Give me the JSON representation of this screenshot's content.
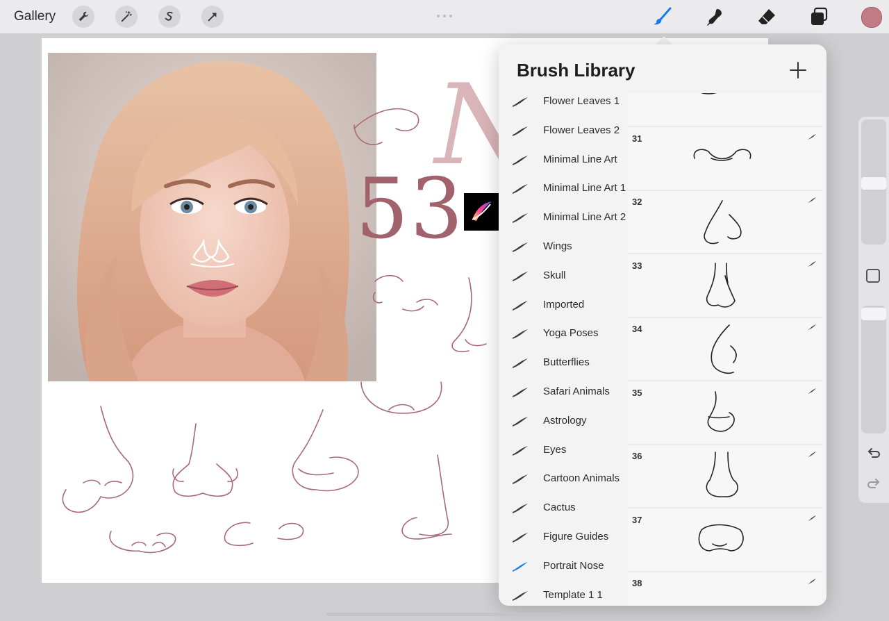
{
  "topbar": {
    "gallery_label": "Gallery",
    "left_tools": [
      "wrench-icon",
      "magic-wand-icon",
      "selection-icon",
      "transform-arrow-icon"
    ],
    "right_tools": [
      "brush-icon",
      "smudge-icon",
      "eraser-icon",
      "layers-icon"
    ],
    "active_tool": "brush-icon",
    "accent_color": "#1a7cf0",
    "current_color": "#c07b84"
  },
  "canvas": {
    "headline_number": "53",
    "headline_letter": "N",
    "text_color": "#a2626c"
  },
  "brush_library": {
    "title": "Brush Library",
    "add_button": "+",
    "sets": [
      {
        "label": "Flower Leaves 1"
      },
      {
        "label": "Flower Leaves 2"
      },
      {
        "label": "Minimal Line Art"
      },
      {
        "label": "Minimal Line Art 1"
      },
      {
        "label": "Minimal Line Art 2"
      },
      {
        "label": "Wings"
      },
      {
        "label": "Skull"
      },
      {
        "label": "Imported"
      },
      {
        "label": "Yoga Poses"
      },
      {
        "label": "Butterflies"
      },
      {
        "label": "Safari Animals"
      },
      {
        "label": "Astrology"
      },
      {
        "label": "Eyes"
      },
      {
        "label": "Cartoon Animals"
      },
      {
        "label": "Cactus"
      },
      {
        "label": "Figure Guides"
      },
      {
        "label": "Portrait Nose",
        "selected": true
      },
      {
        "label": "Template 1 1"
      }
    ],
    "brushes": [
      {
        "number": ""
      },
      {
        "number": "31"
      },
      {
        "number": "32"
      },
      {
        "number": "33"
      },
      {
        "number": "34"
      },
      {
        "number": "35"
      },
      {
        "number": "36"
      },
      {
        "number": "37"
      },
      {
        "number": "38"
      }
    ]
  },
  "sidebar": {
    "size_slider_level": 0.49,
    "opacity_slider_level": 0.97,
    "buttons": [
      "modify-square-icon",
      "undo-icon",
      "redo-icon"
    ]
  }
}
